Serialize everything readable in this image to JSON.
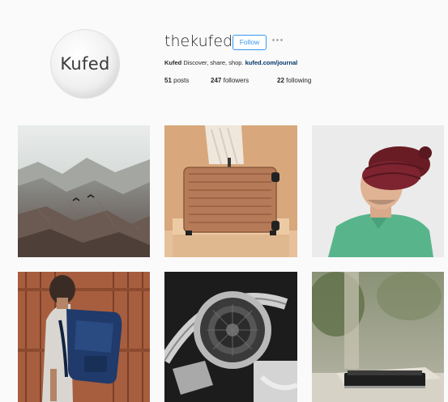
{
  "profile": {
    "avatar_text": "Kufed",
    "username": "thekufed",
    "follow_label": "Follow",
    "bio_name": "Kufed",
    "bio_text": "Discover, share, shop.",
    "bio_link": "kufed.com/journal",
    "stats": {
      "posts_count": "51",
      "posts_label": "posts",
      "followers_count": "247",
      "followers_label": "followers",
      "following_count": "22",
      "following_label": "following"
    }
  },
  "colors": {
    "accent": "#3897f0",
    "background": "#fafafa",
    "text": "#262626",
    "link": "#003569"
  },
  "posts": [
    {
      "subject": "mountain-landscape-with-birds"
    },
    {
      "subject": "copper-suitcase"
    },
    {
      "subject": "man-with-sleep-pillow-hood"
    },
    {
      "subject": "man-with-blue-backpack"
    },
    {
      "subject": "headphones"
    },
    {
      "subject": "device-on-table-outdoors"
    }
  ]
}
